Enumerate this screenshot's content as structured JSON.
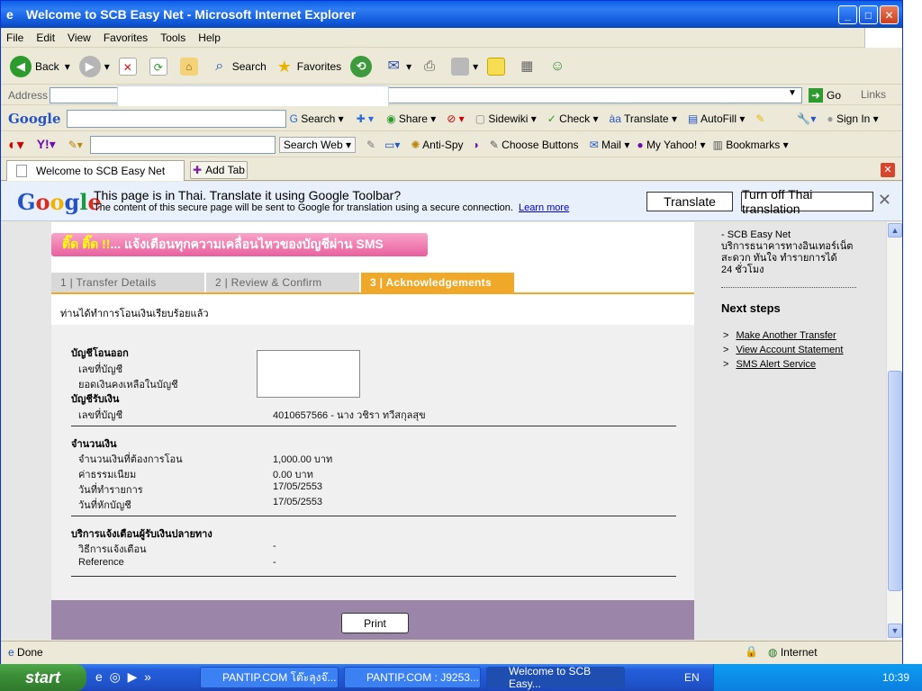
{
  "window": {
    "title": "Welcome to SCB Easy Net - Microsoft Internet Explorer"
  },
  "menu": [
    "File",
    "Edit",
    "View",
    "Favorites",
    "Tools",
    "Help"
  ],
  "toolbar": {
    "back": "Back",
    "search": "Search",
    "favorites": "Favorites"
  },
  "address": {
    "label": "Address",
    "go": "Go",
    "links": "Links"
  },
  "google_toolbar": {
    "logo": "Google",
    "search": "Search",
    "share": "Share",
    "sidewiki": "Sidewiki",
    "check": "Check",
    "translate": "Translate",
    "autofill": "AutoFill",
    "signin": "Sign In"
  },
  "yahoo_toolbar": {
    "search_web": "Search Web",
    "anti_spy": "Anti-Spy",
    "choose_buttons": "Choose Buttons",
    "mail": "Mail",
    "my_yahoo": "My Yahoo!",
    "bookmarks": "Bookmarks"
  },
  "tabs": {
    "current": "Welcome to SCB Easy Net",
    "add": "Add Tab"
  },
  "translate_bar": {
    "logo": "Google",
    "message": "This page is in Thai.  Translate it using Google Toolbar?",
    "sub": "The content of this secure page will be sent to Google for translation using a secure connection.",
    "learn_more": "Learn more",
    "translate_btn": "Translate",
    "turn_off_btn": "Turn off Thai translation"
  },
  "page": {
    "banner_a": "ติ๊ด ติ๊ด !!",
    "banner_b": " ... แจ้งเตือนทุกความเคลื่อนไหวของบัญชีผ่าน SMS",
    "steps": [
      "1 | Transfer Details",
      "2 | Review & Confirm",
      "3 | Acknowledgements"
    ],
    "done_message": "ท่านได้ทำการโอนเงินเรียบร้อยแล้ว",
    "from_account_title": "บัญชีโอนออก",
    "from_account_no_label": "เลขที่บัญชี",
    "from_balance_label": "ยอดเงินคงเหลือในบัญชี",
    "to_account_title": "บัญชีรับเงิน",
    "to_account_no_label": "เลขที่บัญชี",
    "to_account_value": "4010657566 - นาง วชิรา ทวีสกุลสุข",
    "amount_title": "จำนวนเงิน",
    "amount_label": "จำนวนเงินที่ต้องการโอน",
    "amount_value": "1,000.00 บาท",
    "fee_label": "ค่าธรรมเนียม",
    "fee_value": "0.00 บาท",
    "txn_date_label": "วันที่ทำรายการ",
    "txn_date_value": "17/05/2553",
    "debit_date_label": "วันที่หักบัญชี",
    "debit_date_value": "17/05/2553",
    "notify_title": "บริการแจ้งเตือนผู้รับเงินปลายทาง",
    "notify_method_label": "วิธีการแจ้งเตือน",
    "notify_method_value": "-",
    "reference_label": "Reference",
    "reference_value": "-",
    "print": "Print"
  },
  "sidebar": {
    "about": "- SCB Easy Net\nบริการธนาคารทางอินเทอร์เน็ต\nสะดวก ทันใจ ทำรายการได้\n24 ชั่วโมง",
    "next_steps_title": "Next steps",
    "links": [
      "Make Another Transfer",
      "View Account Statement",
      "SMS Alert Service"
    ]
  },
  "status": {
    "text": "Done",
    "zone": "Internet"
  },
  "taskbar": {
    "start": "start",
    "tasks": [
      "PANTIP.COM โต๊ะลุงจ๊...",
      "PANTIP.COM : J9253...",
      "Welcome to SCB Easy..."
    ],
    "lang": "EN",
    "clock": "10:39"
  },
  "colors": {
    "title_blue": "#0a5fe6",
    "step_active": "#f0a828",
    "footer_purple": "#9b86aa",
    "banner_pink": "#e8609f"
  }
}
